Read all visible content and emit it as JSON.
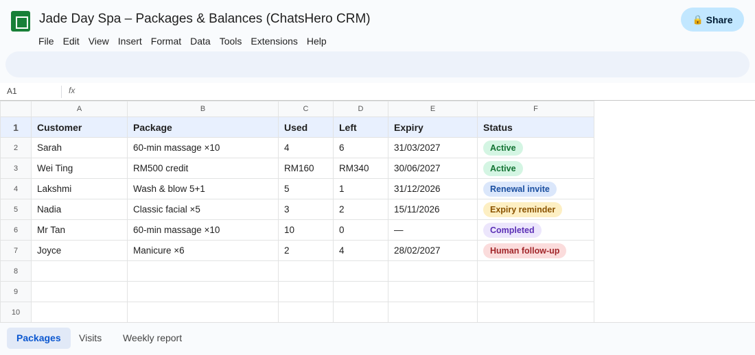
{
  "doc": {
    "title": "Jade Day Spa – Packages & Balances (ChatsHero CRM)",
    "share_label": "Share",
    "icon": "lock-icon"
  },
  "menu": [
    "File",
    "Edit",
    "View",
    "Insert",
    "Format",
    "Data",
    "Tools",
    "Extensions",
    "Help"
  ],
  "formula": {
    "cell_ref": "A1",
    "fx": "fx"
  },
  "grid": {
    "columns": [
      "A",
      "B",
      "C",
      "D",
      "E",
      "F"
    ],
    "row_numbers": [
      "1",
      "2",
      "3",
      "4",
      "5",
      "6",
      "7",
      "8",
      "9",
      "10"
    ],
    "headers": [
      "Customer",
      "Package",
      "Used",
      "Left",
      "Expiry",
      "Status"
    ],
    "rows": [
      [
        "Sarah",
        "60-min massage ×10",
        "4",
        "6",
        "31/03/2027",
        "Active"
      ],
      [
        "Wei Ting",
        "RM500 credit",
        "RM160",
        "RM340",
        "30/06/2027",
        "Active"
      ],
      [
        "Lakshmi",
        "Wash & blow 5+1",
        "5",
        "1",
        "31/12/2026",
        "Renewal invite"
      ],
      [
        "Nadia",
        "Classic facial ×5",
        "3",
        "2",
        "15/11/2026",
        "Expiry reminder"
      ],
      [
        "Mr Tan",
        "60-min massage ×10",
        "10",
        "0",
        "—",
        "Completed"
      ],
      [
        "Joyce",
        "Manicure ×6",
        "2",
        "4",
        "28/02/2027",
        "Human follow-up"
      ]
    ],
    "status_colors": {
      "Active": {
        "bg": "#d4f5e3",
        "fg": "#137333"
      },
      "Renewal invite": {
        "bg": "#dbe7fb",
        "fg": "#1a4fa0"
      },
      "Expiry reminder": {
        "bg": "#fdefc3",
        "fg": "#8a5300"
      },
      "Completed": {
        "bg": "#ece6fc",
        "fg": "#5b2fb5"
      },
      "Human follow-up": {
        "bg": "#fbdcdc",
        "fg": "#a1262a"
      }
    }
  },
  "tabs": [
    {
      "label": "Packages",
      "active": true
    },
    {
      "label": "Visits",
      "active": false
    },
    {
      "label": "Weekly report",
      "active": false
    }
  ]
}
